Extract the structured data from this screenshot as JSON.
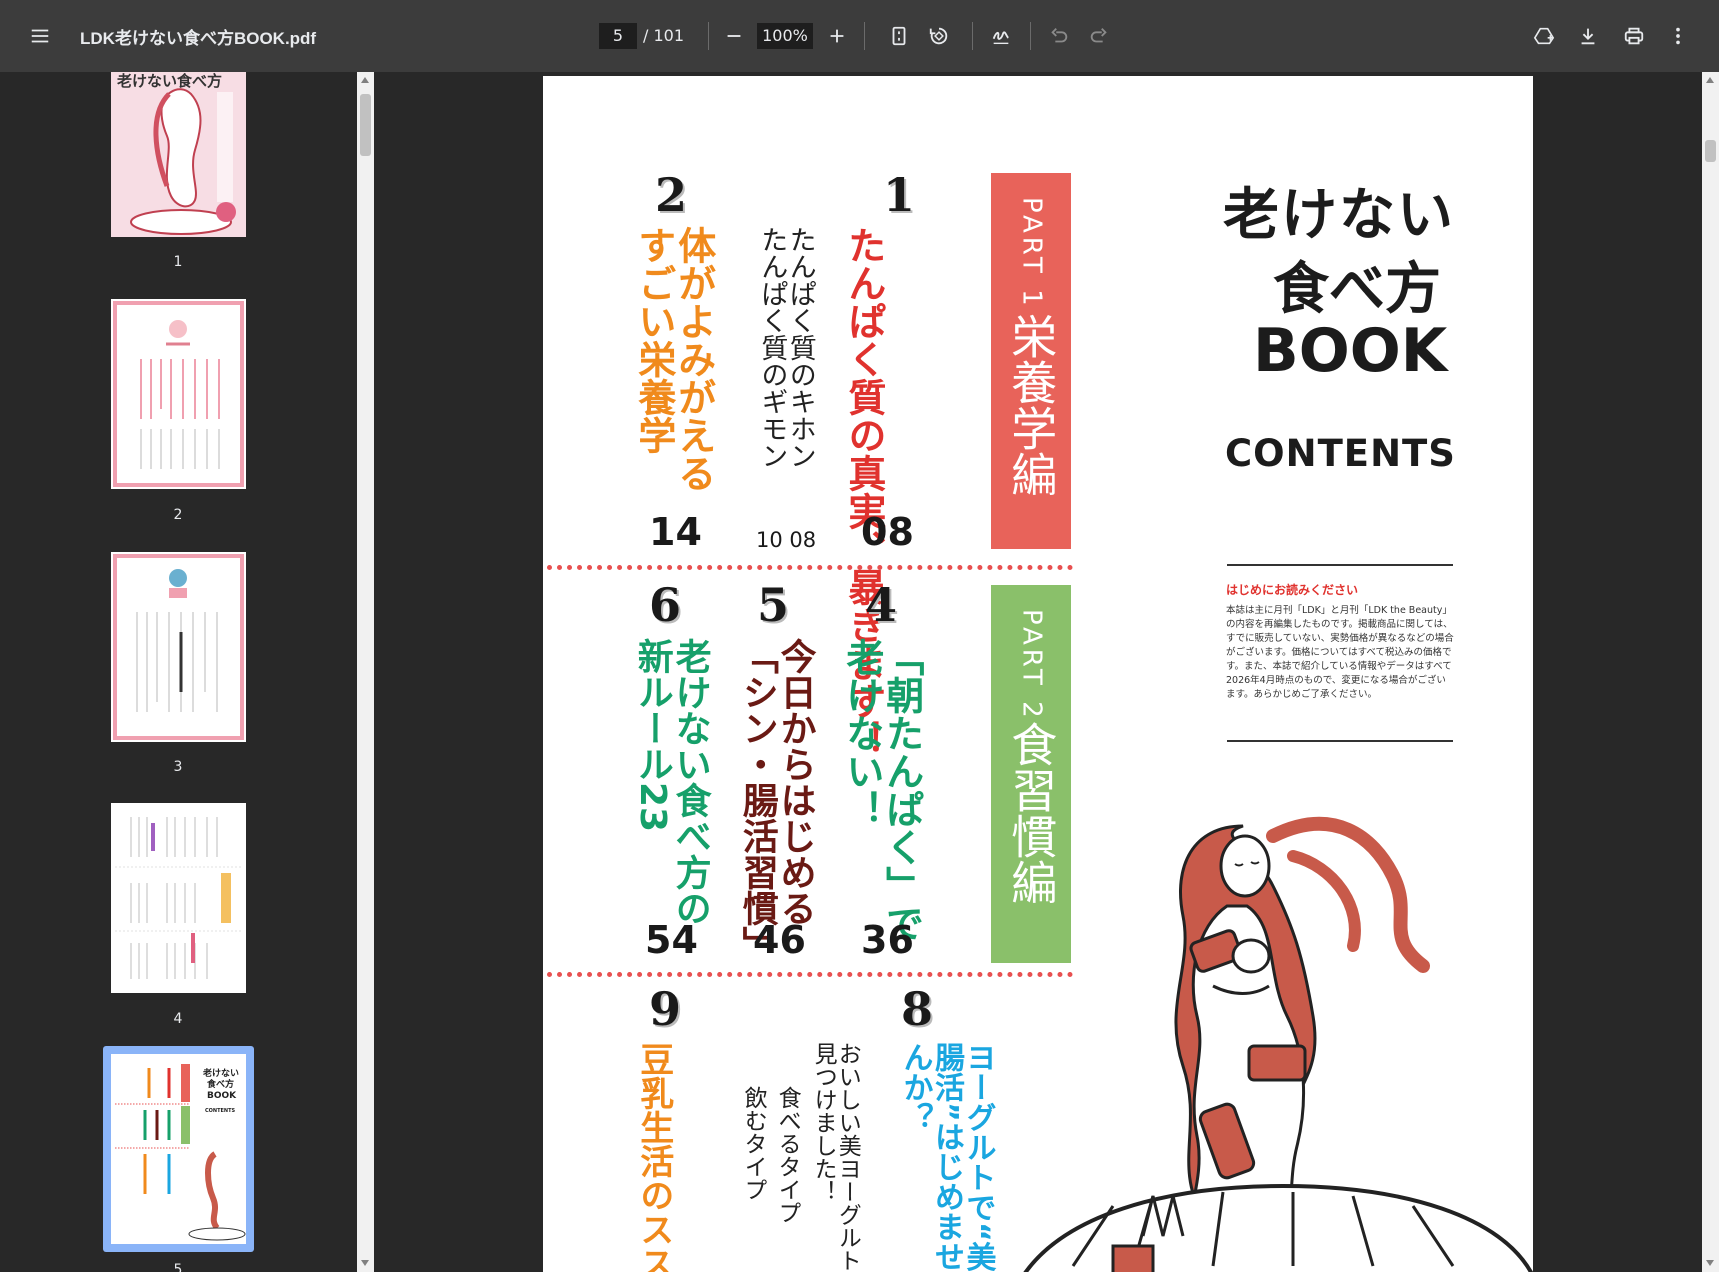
{
  "toolbar": {
    "title": "LDK老けない食べ方BOOK.pdf",
    "current_page": "5",
    "total_pages": "/ 101",
    "zoom": "100%",
    "icons": [
      "menu-icon",
      "zoom-out-icon",
      "zoom-in-icon",
      "fit-page-icon",
      "rotate-icon",
      "annotate-icon",
      "undo-icon",
      "redo-icon",
      "drive-icon",
      "download-icon",
      "print-icon",
      "more-icon"
    ]
  },
  "thumbnails": [
    {
      "label": "1"
    },
    {
      "label": "2"
    },
    {
      "label": "3"
    },
    {
      "label": "4"
    },
    {
      "label": "5",
      "selected": true
    }
  ],
  "colors": {
    "red": "#e8635a",
    "green": "#8ac06a",
    "orange": "#f08a1c",
    "crimson": "#e0322e",
    "teal": "#16a06a",
    "darkred": "#6a1a14",
    "cyan": "#1aa6e0",
    "selection": "#8ab4f8"
  },
  "contents": {
    "title_line1": "老けない",
    "title_line2": "食べ方",
    "title_line3": "BOOK",
    "contents_label": "CONTENTS",
    "notice_title": "はじめにお読みください",
    "notice_body": "本誌は主に月刊「LDK」と月刊「LDK the Beauty」の内容を再編集したものです。掲載商品に関しては、すでに販売していない、実勢価格が異なるなどの場合がございます。価格についてはすべて税込みの価格です。また、本誌で紹介している情報やデータはすべて2026年4月時点のもので、変更になる場合がございます。あらかじめご了承ください。",
    "part1": "PART 1",
    "part1_title": "栄養学編",
    "part2": "PART 2",
    "part2_title": "食習慣編",
    "items": [
      {
        "num": "1",
        "title": "たんぱく質の真実、暴きます！",
        "page": "08"
      },
      {
        "sub1": "たんぱく質のキホン",
        "sub2": "たんぱく質のギモン",
        "pages": "10 08"
      },
      {
        "num": "2",
        "title": "体がよみがえるすごい栄養学",
        "page": "14"
      },
      {
        "num": "4",
        "title": "「朝たんぱく」で老けない！",
        "page": "36"
      },
      {
        "num": "5",
        "title": "今日からはじめる「シン・腸活習慣」",
        "page": "46"
      },
      {
        "num": "6",
        "title": "老けない食べ方の新ルール23",
        "page": "54"
      },
      {
        "num": "8",
        "title": "ヨーグルトで“美腸活”はじめませんか？",
        "sub_a": "おいしい美ヨーグルト見つけました！",
        "sub_b": "食べるタイプ",
        "sub_c": "飲むタイプ"
      },
      {
        "num": "9",
        "title": "豆乳生活のスス"
      }
    ]
  }
}
